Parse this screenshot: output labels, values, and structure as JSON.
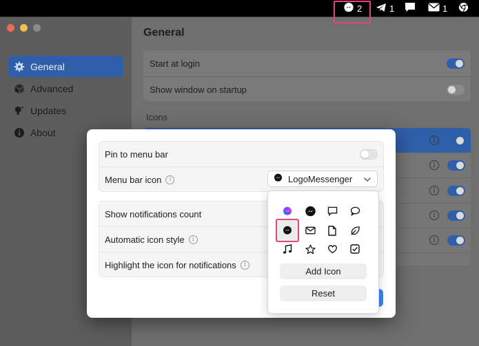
{
  "menubar": {
    "messenger_count": "2",
    "telegram_count": "1",
    "mail_count": "1",
    "icons": [
      "messenger-icon",
      "telegram-icon",
      "chat-bubble-icon",
      "mail-icon",
      "chrome-icon"
    ]
  },
  "sidebar": {
    "items": [
      {
        "label": "General",
        "icon": "gear-icon",
        "active": true
      },
      {
        "label": "Advanced",
        "icon": "cube-icon",
        "active": false
      },
      {
        "label": "Updates",
        "icon": "lightbulb-icon",
        "active": false
      },
      {
        "label": "About",
        "icon": "info-icon",
        "active": false
      }
    ]
  },
  "main": {
    "title": "General",
    "rows": [
      {
        "label": "Start at login",
        "on": true
      },
      {
        "label": "Show window on startup",
        "on": false
      }
    ],
    "icons_section_label": "Icons"
  },
  "sheet": {
    "pin_label": "Pin to menu bar",
    "pin_on": false,
    "menu_bar_icon_label": "Menu bar icon",
    "menu_bar_icon_value": "LogoMessenger",
    "show_count_label": "Show notifications count",
    "auto_style_label": "Automatic icon style",
    "highlight_label": "Highlight the icon for notifications"
  },
  "picker": {
    "icons": [
      "messenger-logo-color-icon",
      "messenger-logo-icon",
      "square-bubble-icon",
      "round-bubble-icon",
      "messenger-bubble-icon",
      "envelope-icon",
      "document-icon",
      "leaf-icon",
      "music-note-icon",
      "star-icon",
      "heart-icon",
      "checkbox-icon"
    ],
    "selected_icon": "messenger-bubble-icon",
    "add_label": "Add Icon",
    "reset_label": "Reset"
  },
  "colors": {
    "accent": "#2f5fa8",
    "highlight": "#e0457b",
    "primary_button": "#3b82f6"
  }
}
